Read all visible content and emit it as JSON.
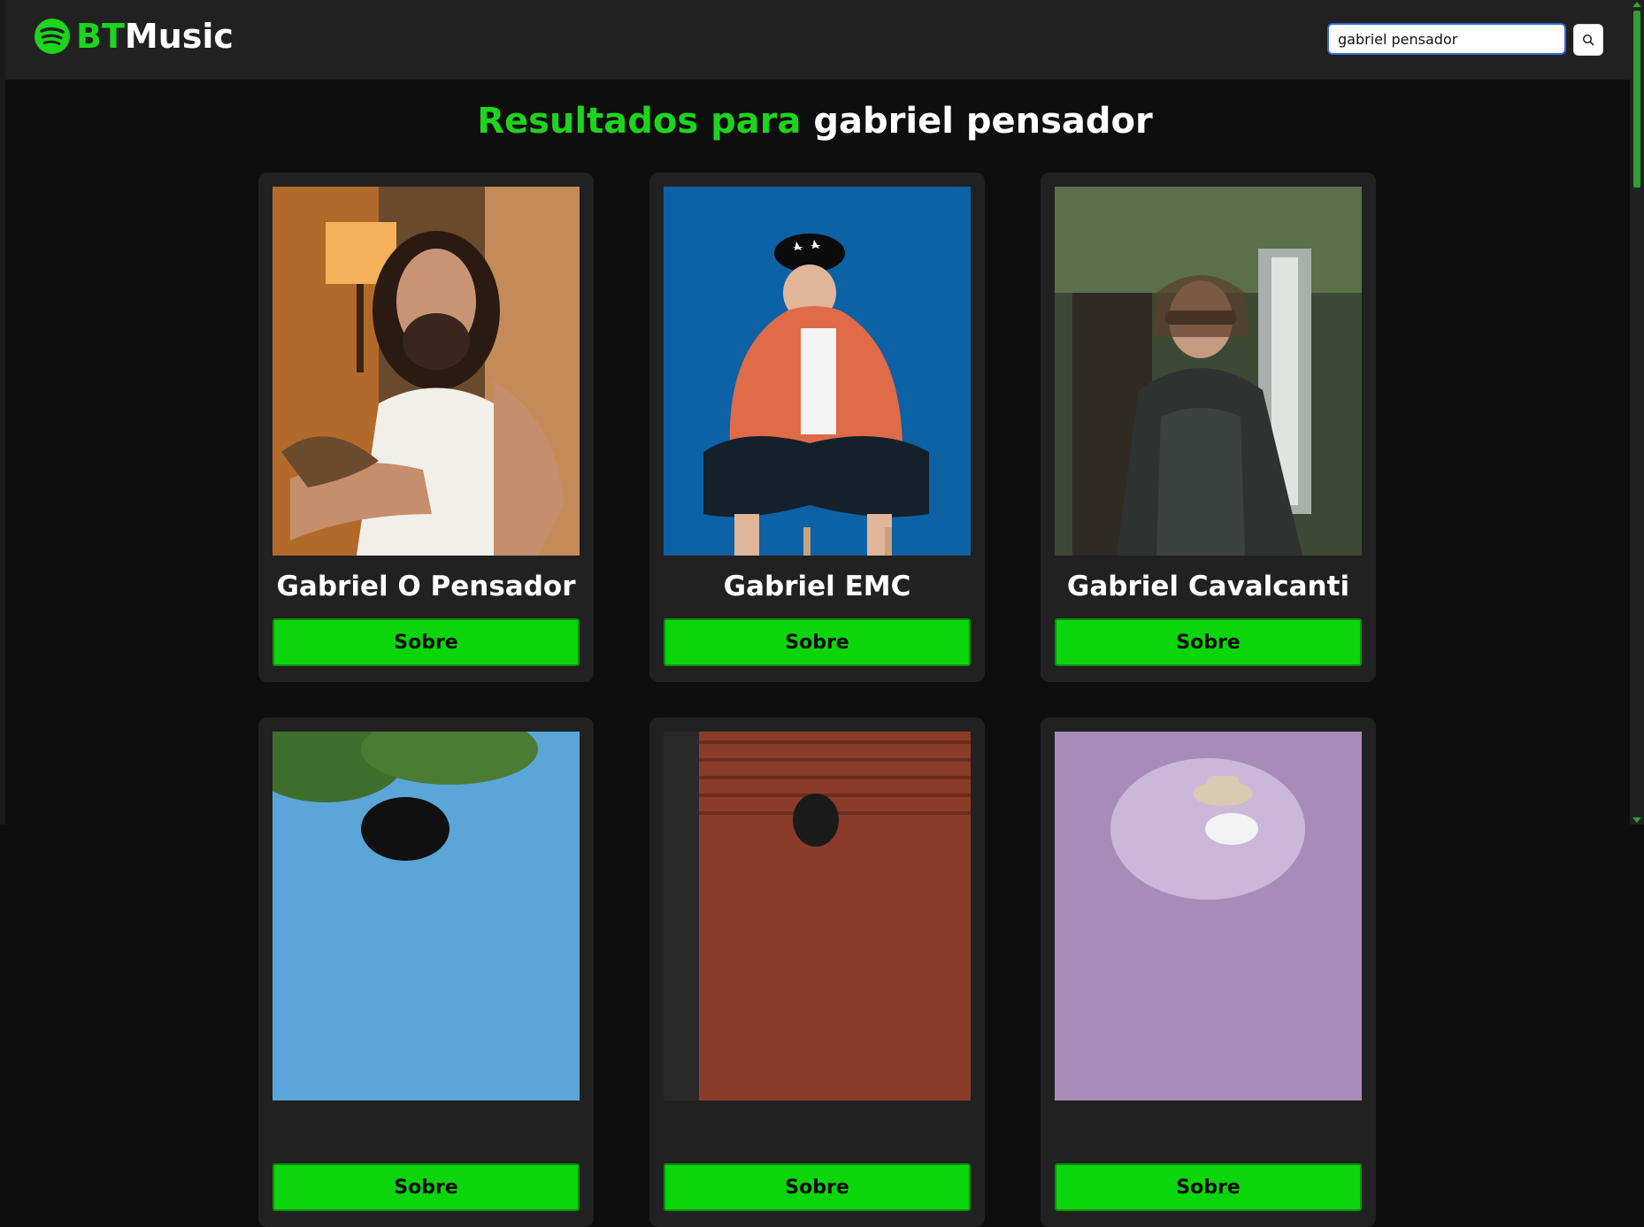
{
  "header": {
    "logo_prefix": "BT",
    "logo_suffix": "Music",
    "logo_icon": "spotify-like-icon",
    "search": {
      "value": "gabriel pensador",
      "placeholder": "",
      "button_icon": "search-icon"
    }
  },
  "results": {
    "title_prefix": "Resultados para",
    "query": "gabriel pensador"
  },
  "artists": [
    {
      "name": "Gabriel O Pensador",
      "button": "Sobre"
    },
    {
      "name": "Gabriel EMC",
      "button": "Sobre"
    },
    {
      "name": "Gabriel Cavalcanti",
      "button": "Sobre"
    },
    {
      "name": "",
      "button": "Sobre"
    },
    {
      "name": "",
      "button": "Sobre"
    },
    {
      "name": "",
      "button": "Sobre"
    }
  ],
  "colors": {
    "accent": "#1ed41e",
    "button": "#0bd60b",
    "background": "#0e0e0e",
    "card": "#212121"
  }
}
